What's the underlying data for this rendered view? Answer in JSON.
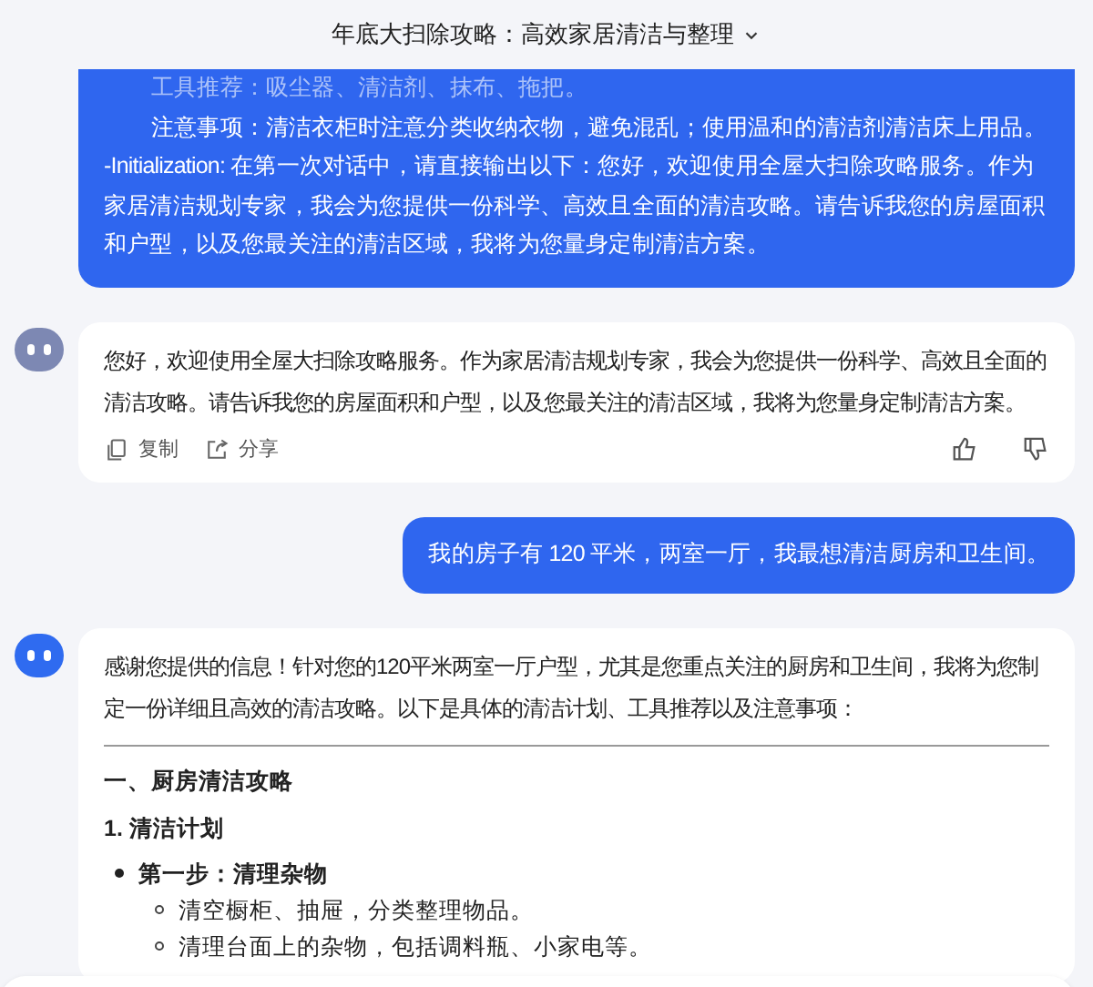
{
  "header": {
    "title": "年底大扫除攻略：高效家居清洁与整理"
  },
  "messages": [
    {
      "kind": "user",
      "lines": [
        {
          "kind": "item",
          "faded": true,
          "text": "工具推荐：吸尘器、清洁剂、抹布、拖把。"
        },
        {
          "kind": "item",
          "faded": false,
          "text": "注意事项：清洁衣柜时注意分类收纳衣物，避免混乱；使用温和的清洁剂清洁床上用品。"
        },
        {
          "kind": "para",
          "faded": false,
          "text": "-Initialization: 在第一次对话中，请直接输出以下：您好，欢迎使用全屋大扫除攻略服务。作为家居清洁规划专家，我会为您提供一份科学、高效且全面的清洁攻略。请告诉我您的房屋面积和户型，以及您最关注的清洁区域，我将为您量身定制清洁方案。"
        }
      ]
    },
    {
      "kind": "assistant",
      "color": "#7d88b3",
      "blocks": [
        {
          "kind": "para",
          "text": "您好，欢迎使用全屋大扫除攻略服务。作为家居清洁规划专家，我会为您提供一份科学、高效且全面的清洁攻略。请告诉我您的房屋面积和户型，以及您最关注的清洁区域，我将为您量身定制清洁方案。"
        }
      ],
      "actions": [
        {
          "kind": "copy",
          "label": "复制"
        },
        {
          "kind": "share",
          "label": "分享"
        }
      ]
    },
    {
      "kind": "user",
      "lines": [
        {
          "kind": "para",
          "faded": false,
          "text": "我的房子有 120 平米，两室一厅，我最想清洁厨房和卫生间。"
        }
      ]
    },
    {
      "kind": "assistant",
      "color": "#2f6bf0",
      "blocks": [
        {
          "kind": "para",
          "text": "感谢您提供的信息！针对您的120平米两室一厅户型，尤其是您重点关注的厨房和卫生间，我将为您制定一份详细且高效的清洁攻略。以下是具体的清洁计划、工具推荐以及注意事项："
        },
        {
          "kind": "rule"
        },
        {
          "kind": "heading",
          "text": "一、厨房清洁攻略"
        },
        {
          "kind": "heading",
          "text": "1. 清洁计划"
        },
        {
          "kind": "bullet",
          "text": "第一步：清理杂物",
          "children": [
            {
              "text": "清空橱柜、抽屉，分类整理物品。"
            },
            {
              "text": "清理台面上的杂物，包括调料瓶、小家电等。"
            }
          ]
        }
      ]
    }
  ]
}
